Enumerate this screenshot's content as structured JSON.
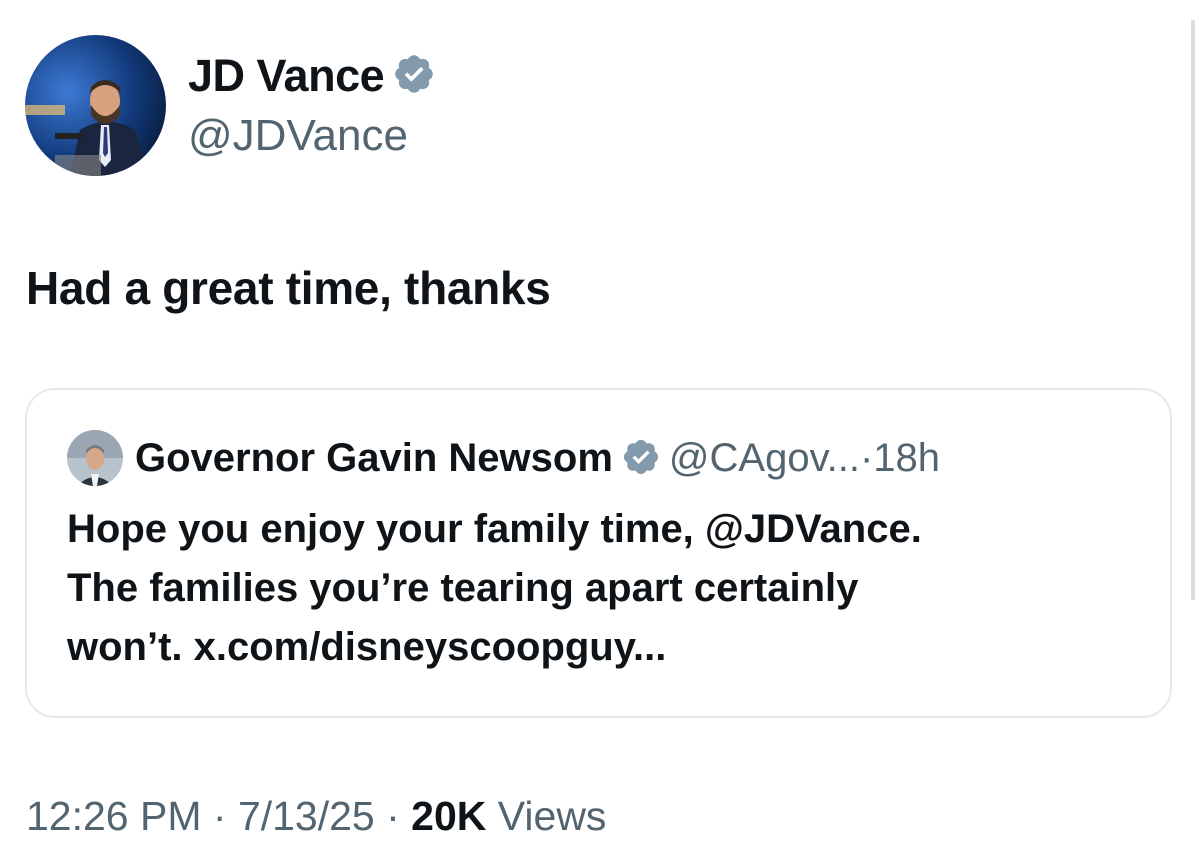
{
  "author": {
    "display_name": "JD Vance",
    "handle": "@JDVance",
    "verified_icon": "verified-badge-icon"
  },
  "tweet": {
    "text": "Had a great time, thanks"
  },
  "quoted_tweet": {
    "display_name": "Governor Gavin Newsom",
    "handle": "@CAgov...",
    "separator": "·",
    "time": "18h",
    "text": "Hope you enjoy your family time, @JDVance.\nThe families you’re tearing apart certainly\nwon’t. x.com/disneyscoopguy..."
  },
  "footer": {
    "time": "12:26 PM",
    "date": "7/13/25",
    "views_count": "20K",
    "views_label": "Views"
  },
  "colors": {
    "text": "#0f1419",
    "secondary": "#536471",
    "badge": "#829aab",
    "border": "#e6e9ec"
  }
}
